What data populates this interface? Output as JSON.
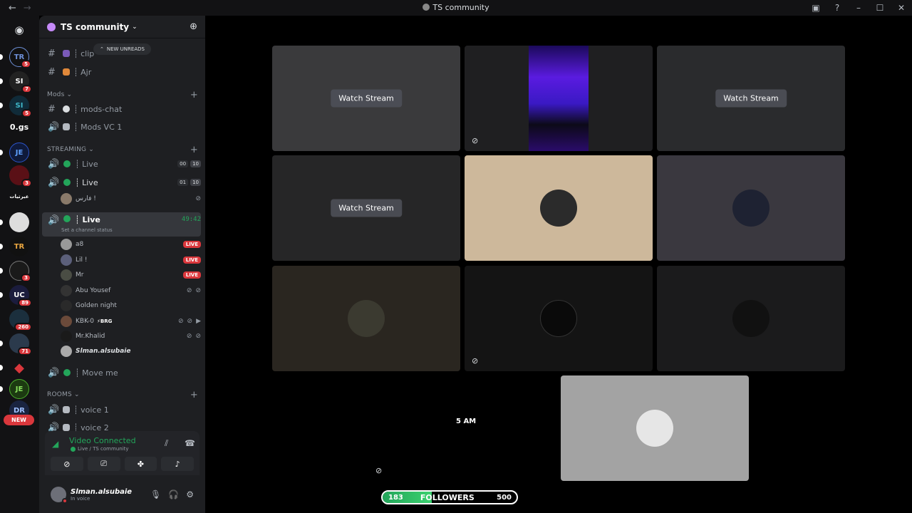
{
  "window": {
    "title": "TS community",
    "nav_back": "←",
    "nav_forward": "→"
  },
  "guilds": [
    {
      "label": "TR",
      "badge": "5"
    },
    {
      "label": "SI",
      "badge": "7"
    },
    {
      "label": "SI",
      "badge": "5"
    },
    {
      "label": "0.gs",
      "badge": ""
    },
    {
      "label": "JE",
      "badge": ""
    },
    {
      "label": "",
      "badge": "3"
    },
    {
      "label": "عبرتيات",
      "badge": ""
    },
    {
      "label": "",
      "badge": ""
    },
    {
      "label": "TR",
      "badge": ""
    },
    {
      "label": "",
      "badge": "3"
    },
    {
      "label": "UC",
      "badge": "89"
    },
    {
      "label": "",
      "badge": "260"
    },
    {
      "label": "",
      "badge": "71"
    },
    {
      "label": "",
      "badge": ""
    },
    {
      "label": "JE",
      "badge": ""
    },
    {
      "label": "DR",
      "badge": ""
    }
  ],
  "new_badge": "NEW",
  "server": {
    "name": "TS community"
  },
  "unreads_pill": "NEW UNREADS",
  "channels": {
    "clip": "┊ clip",
    "ajr": "┊ Ajr",
    "mods_category": "Mods",
    "mods_chat": "┊ mods-chat",
    "mods_vc": "┊ Mods VC 1",
    "streaming_category": "STREAMING",
    "live1": "┊ Live",
    "live1_count": "00",
    "live1_limit": "10",
    "live2": "┊ Live",
    "live2_count": "01",
    "live2_limit": "10",
    "live2_user": "فارس !",
    "live3": "┊ Live",
    "live3_timer": "49:42",
    "live3_status": "Set a channel status",
    "move_me": "┊ Move me",
    "rooms_category": "ROOMS",
    "voice1": "┊ voice 1",
    "voice2": "┊ voice 2"
  },
  "users": [
    {
      "name": "a8",
      "badge": "LIVE"
    },
    {
      "name": "Lil !",
      "badge": "LIVE"
    },
    {
      "name": "Mr",
      "badge": "LIVE"
    },
    {
      "name": "Abu Yousef",
      "badge": ""
    },
    {
      "name": "Golden night",
      "badge": ""
    },
    {
      "name": "KBK-0",
      "badge": "",
      "tag": "⚡BRG"
    },
    {
      "name": "Mr.Khalid",
      "badge": ""
    },
    {
      "name": "Slman.alsubaie",
      "badge": ""
    }
  ],
  "voice_panel": {
    "status": "Video Connected",
    "channel": "Live / TS community"
  },
  "user_bar": {
    "name": "Slman.alsubaie",
    "status": "In voice"
  },
  "stage": {
    "watch_label": "Watch Stream",
    "ampm": "5 AM",
    "followers": {
      "current": "183",
      "label": "FOLLOWERS",
      "goal": "500",
      "progress": 0.366
    }
  }
}
